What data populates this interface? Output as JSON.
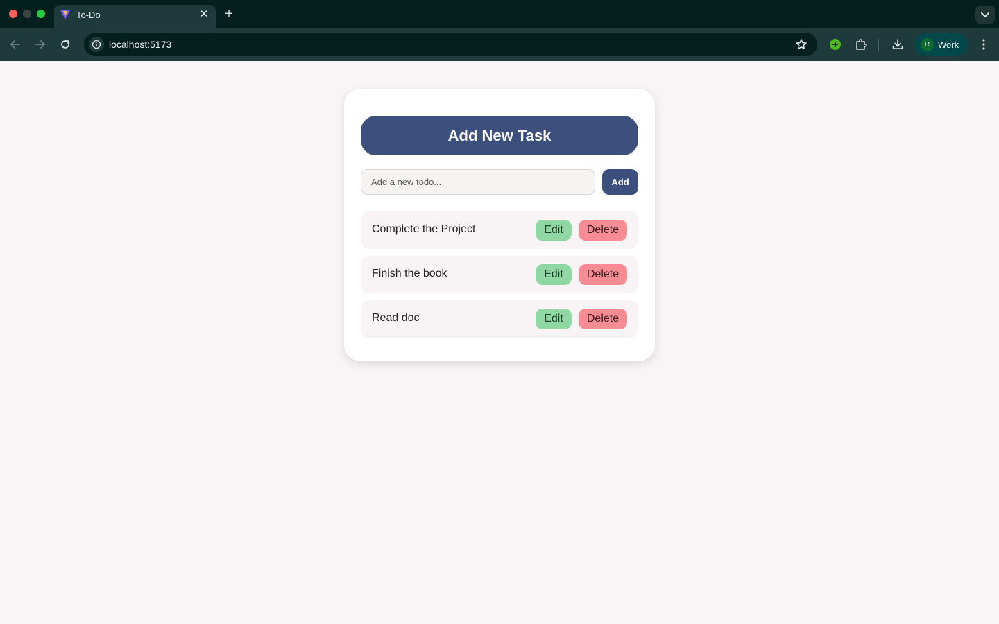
{
  "browser": {
    "tab_title": "To-Do",
    "url": "localhost:5173",
    "profile_initial": "R",
    "profile_label": "Work",
    "new_tab_symbol": "+",
    "close_symbol": "✕"
  },
  "colors": {
    "heading_bg": "#3d4f7c",
    "edit_bg": "#8fd8a3",
    "delete_bg": "#f88c94",
    "page_bg": "#f9f5f6",
    "chrome_bg": "#03201f",
    "toolbar_bg": "#1e3a3a"
  },
  "icons": [
    "back-arrow-icon",
    "forward-arrow-icon",
    "reload-icon",
    "site-info-icon",
    "bookmark-star-icon",
    "extension-add-icon",
    "puzzle-icon",
    "download-icon",
    "more-menu-icon",
    "tab-search-chevron-icon",
    "vite-favicon-icon"
  ],
  "app": {
    "heading": "Add New Task",
    "input_placeholder": "Add a new todo...",
    "input_value": "",
    "add_label": "Add",
    "todos": [
      {
        "text": "Complete the Project",
        "edit_label": "Edit",
        "delete_label": "Delete"
      },
      {
        "text": "Finish the book",
        "edit_label": "Edit",
        "delete_label": "Delete"
      },
      {
        "text": "Read doc",
        "edit_label": "Edit",
        "delete_label": "Delete"
      }
    ]
  }
}
